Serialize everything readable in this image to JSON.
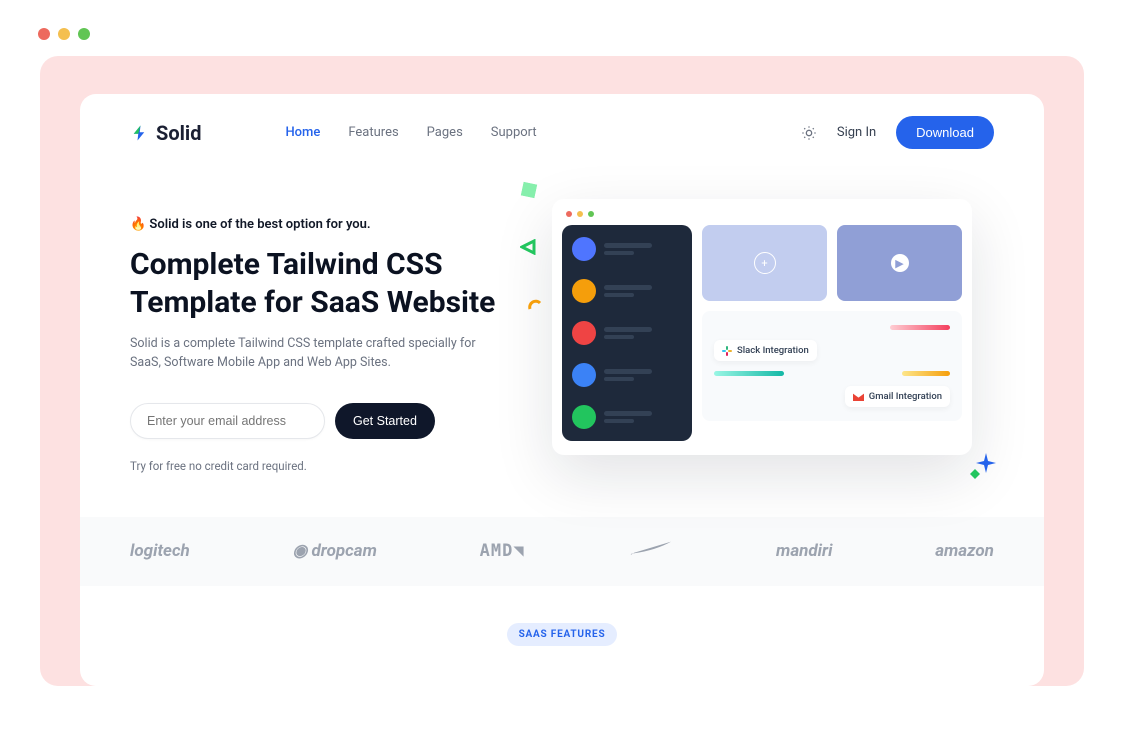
{
  "brand": "Solid",
  "nav": {
    "items": [
      "Home",
      "Features",
      "Pages",
      "Support"
    ],
    "signin": "Sign In",
    "download": "Download"
  },
  "hero": {
    "eyebrow": "🔥 Solid is one of the best option for you.",
    "heading": "Complete Tailwind CSS Template for SaaS Website",
    "description": "Solid is a complete Tailwind CSS template crafted specially for SaaS, Software Mobile App and Web App Sites.",
    "email_placeholder": "Enter your email address",
    "cta": "Get Started",
    "note": "Try for free no credit card required."
  },
  "mock": {
    "integrations": {
      "slack": "Slack Integration",
      "gmail": "Gmail Integration"
    }
  },
  "clients": [
    "logitech",
    "dropcam",
    "AMD",
    "nike",
    "mandiri",
    "amazon"
  ],
  "features_tag": "SAAS FEATURES"
}
